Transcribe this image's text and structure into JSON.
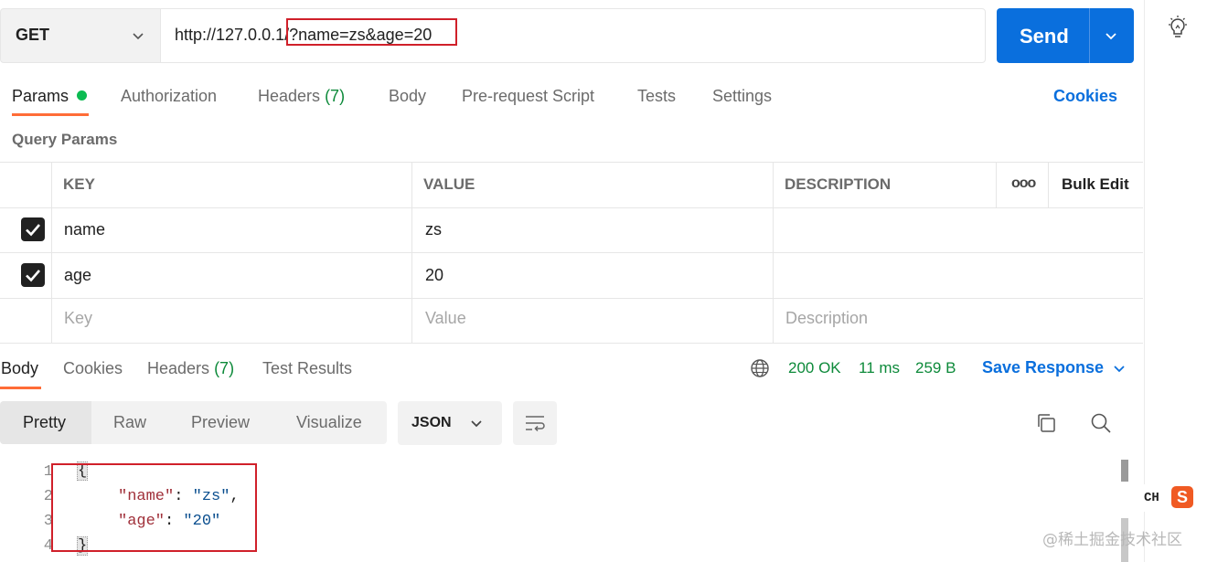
{
  "request": {
    "method": "GET",
    "url_prefix": "http://127.0.0.1/",
    "url_query": "?name=zs&age=20",
    "send_label": "Send"
  },
  "request_tabs": {
    "params": "Params",
    "authorization": "Authorization",
    "headers": "Headers",
    "headers_count": "(7)",
    "body": "Body",
    "pre_request": "Pre-request Script",
    "tests": "Tests",
    "settings": "Settings",
    "cookies": "Cookies"
  },
  "query_params": {
    "title": "Query Params",
    "columns": {
      "key": "KEY",
      "value": "VALUE",
      "description": "DESCRIPTION"
    },
    "more": "ooo",
    "bulk_edit": "Bulk Edit",
    "rows": [
      {
        "checked": true,
        "key": "name",
        "value": "zs",
        "description": ""
      },
      {
        "checked": true,
        "key": "age",
        "value": "20",
        "description": ""
      }
    ],
    "placeholders": {
      "key": "Key",
      "value": "Value",
      "description": "Description"
    }
  },
  "response_tabs": {
    "body": "Body",
    "cookies": "Cookies",
    "headers": "Headers",
    "headers_count": "(7)",
    "test_results": "Test Results"
  },
  "response_status": {
    "status": "200 OK",
    "time": "11 ms",
    "size": "259 B",
    "save_response": "Save Response"
  },
  "view_modes": [
    "Pretty",
    "Raw",
    "Preview",
    "Visualize"
  ],
  "format": "JSON",
  "code": {
    "line_numbers": [
      "1",
      "2",
      "3",
      "4"
    ],
    "open_brace": "{",
    "key1": "\"name\"",
    "val1": "\"zs\"",
    "key2": "\"age\"",
    "val2": "\"20\"",
    "close_brace": "}"
  },
  "ime": {
    "label": "CH",
    "logo": "S"
  },
  "watermark": "@稀土掘金技术社区",
  "colors": {
    "accent": "#0a6fdd",
    "tab_underline": "#ff6c37",
    "status_green": "#0d8a3a",
    "highlight_red": "#d0202a"
  }
}
